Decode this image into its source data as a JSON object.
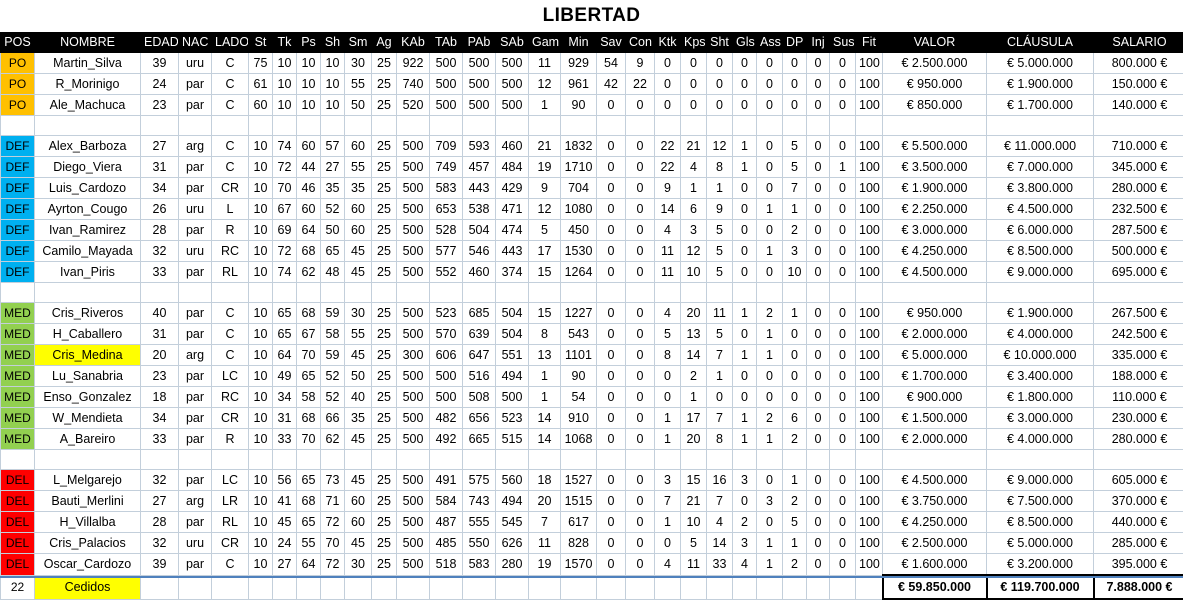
{
  "title": "LIBERTAD",
  "columns": [
    "POS",
    "NOMBRE",
    "EDAD",
    "NAC",
    "LADO",
    "St",
    "Tk",
    "Ps",
    "Sh",
    "Sm",
    "Ag",
    "KAb",
    "TAb",
    "PAb",
    "SAb",
    "Gam",
    "Min",
    "Sav",
    "Con",
    "Ktk",
    "Kps",
    "Sht",
    "Gls",
    "Ass",
    "DP",
    "Inj",
    "Sus",
    "Fit",
    "VALOR",
    "CLÁUSULA",
    "SALARIO"
  ],
  "colors": {
    "pos_po": "#FFC000",
    "pos_def": "#00B0F0",
    "pos_med": "#92D050",
    "pos_del": "#FF0000",
    "highlight": "#FFFF00",
    "header_bg": "#000000",
    "header_fg": "#FFFFFF",
    "gridline": "#C3CFDB"
  },
  "rows": [
    {
      "type": "data",
      "pos": "PO",
      "group": "po",
      "bold_col": "St",
      "name": "Martin_Silva",
      "edad": "39",
      "nac": "uru",
      "lado": "C",
      "st": "75",
      "tk": "10",
      "ps": "10",
      "sh": "10",
      "sm": "30",
      "ag": "25",
      "kab": "922",
      "tab": "500",
      "pab": "500",
      "sab": "500",
      "gam": "11",
      "min": "929",
      "sav": "54",
      "con": "9",
      "ktk": "0",
      "kps": "0",
      "sht": "0",
      "gls": "0",
      "ass": "0",
      "dp": "0",
      "inj": "0",
      "sus": "0",
      "fit": "100",
      "valor": "€ 2.500.000",
      "clausula": "€ 5.000.000",
      "salario": "800.000 €"
    },
    {
      "type": "data",
      "pos": "PO",
      "group": "po",
      "bold_col": "St",
      "name": "R_Morinigo",
      "edad": "24",
      "nac": "par",
      "lado": "C",
      "st": "61",
      "tk": "10",
      "ps": "10",
      "sh": "10",
      "sm": "55",
      "ag": "25",
      "kab": "740",
      "tab": "500",
      "pab": "500",
      "sab": "500",
      "gam": "12",
      "min": "961",
      "sav": "42",
      "con": "22",
      "ktk": "0",
      "kps": "0",
      "sht": "0",
      "gls": "0",
      "ass": "0",
      "dp": "0",
      "inj": "0",
      "sus": "0",
      "fit": "100",
      "valor": "€ 950.000",
      "clausula": "€ 1.900.000",
      "salario": "150.000 €"
    },
    {
      "type": "data",
      "pos": "PO",
      "group": "po",
      "bold_col": "St",
      "name": "Ale_Machuca",
      "edad": "23",
      "nac": "par",
      "lado": "C",
      "st": "60",
      "tk": "10",
      "ps": "10",
      "sh": "10",
      "sm": "50",
      "ag": "25",
      "kab": "520",
      "tab": "500",
      "pab": "500",
      "sab": "500",
      "gam": "1",
      "min": "90",
      "sav": "0",
      "con": "0",
      "ktk": "0",
      "kps": "0",
      "sht": "0",
      "gls": "0",
      "ass": "0",
      "dp": "0",
      "inj": "0",
      "sus": "0",
      "fit": "100",
      "valor": "€ 850.000",
      "clausula": "€ 1.700.000",
      "salario": "140.000 €"
    },
    {
      "type": "spacer"
    },
    {
      "type": "data",
      "pos": "DEF",
      "group": "def",
      "bold_col": "Tk",
      "name": "Alex_Barboza",
      "edad": "27",
      "nac": "arg",
      "lado": "C",
      "st": "10",
      "tk": "74",
      "ps": "60",
      "sh": "57",
      "sm": "60",
      "ag": "25",
      "kab": "500",
      "tab": "709",
      "pab": "593",
      "sab": "460",
      "gam": "21",
      "min": "1832",
      "sav": "0",
      "con": "0",
      "ktk": "22",
      "kps": "21",
      "sht": "12",
      "gls": "1",
      "ass": "0",
      "dp": "5",
      "inj": "0",
      "sus": "0",
      "fit": "100",
      "valor": "€ 5.500.000",
      "clausula": "€ 11.000.000",
      "salario": "710.000 €"
    },
    {
      "type": "data",
      "pos": "DEF",
      "group": "def",
      "bold_col": "Tk",
      "name": "Diego_Viera",
      "edad": "31",
      "nac": "par",
      "lado": "C",
      "st": "10",
      "tk": "72",
      "ps": "44",
      "sh": "27",
      "sm": "55",
      "ag": "25",
      "kab": "500",
      "tab": "749",
      "pab": "457",
      "sab": "484",
      "gam": "19",
      "min": "1710",
      "sav": "0",
      "con": "0",
      "ktk": "22",
      "kps": "4",
      "sht": "8",
      "gls": "1",
      "ass": "0",
      "dp": "5",
      "inj": "0",
      "sus": "1",
      "fit": "100",
      "valor": "€ 3.500.000",
      "clausula": "€ 7.000.000",
      "salario": "345.000 €"
    },
    {
      "type": "data",
      "pos": "DEF",
      "group": "def",
      "bold_col": "Tk",
      "name": "Luis_Cardozo",
      "edad": "34",
      "nac": "par",
      "lado": "CR",
      "st": "10",
      "tk": "70",
      "ps": "46",
      "sh": "35",
      "sm": "35",
      "ag": "25",
      "kab": "500",
      "tab": "583",
      "pab": "443",
      "sab": "429",
      "gam": "9",
      "min": "704",
      "sav": "0",
      "con": "0",
      "ktk": "9",
      "kps": "1",
      "sht": "1",
      "gls": "0",
      "ass": "0",
      "dp": "7",
      "inj": "0",
      "sus": "0",
      "fit": "100",
      "valor": "€ 1.900.000",
      "clausula": "€ 3.800.000",
      "salario": "280.000 €"
    },
    {
      "type": "data",
      "pos": "DEF",
      "group": "def",
      "bold_col": "Tk",
      "name": "Ayrton_Cougo",
      "edad": "26",
      "nac": "uru",
      "lado": "L",
      "st": "10",
      "tk": "67",
      "ps": "60",
      "sh": "52",
      "sm": "60",
      "ag": "25",
      "kab": "500",
      "tab": "653",
      "pab": "538",
      "sab": "471",
      "gam": "12",
      "min": "1080",
      "sav": "0",
      "con": "0",
      "ktk": "14",
      "kps": "6",
      "sht": "9",
      "gls": "0",
      "ass": "1",
      "dp": "1",
      "inj": "0",
      "sus": "0",
      "fit": "100",
      "valor": "€ 2.250.000",
      "clausula": "€ 4.500.000",
      "salario": "232.500 €"
    },
    {
      "type": "data",
      "pos": "DEF",
      "group": "def",
      "bold_col": "Tk",
      "name": "Ivan_Ramirez",
      "edad": "28",
      "nac": "par",
      "lado": "R",
      "st": "10",
      "tk": "69",
      "ps": "64",
      "sh": "50",
      "sm": "60",
      "ag": "25",
      "kab": "500",
      "tab": "528",
      "pab": "504",
      "sab": "474",
      "gam": "5",
      "min": "450",
      "sav": "0",
      "con": "0",
      "ktk": "4",
      "kps": "3",
      "sht": "5",
      "gls": "0",
      "ass": "0",
      "dp": "2",
      "inj": "0",
      "sus": "0",
      "fit": "100",
      "valor": "€ 3.000.000",
      "clausula": "€ 6.000.000",
      "salario": "287.500 €"
    },
    {
      "type": "data",
      "pos": "DEF",
      "group": "def",
      "bold_col": "Tk",
      "name": "Camilo_Mayada",
      "edad": "32",
      "nac": "uru",
      "lado": "RC",
      "st": "10",
      "tk": "72",
      "ps": "68",
      "sh": "65",
      "sm": "45",
      "ag": "25",
      "kab": "500",
      "tab": "577",
      "pab": "546",
      "sab": "443",
      "gam": "17",
      "min": "1530",
      "sav": "0",
      "con": "0",
      "ktk": "11",
      "kps": "12",
      "sht": "5",
      "gls": "0",
      "ass": "1",
      "dp": "3",
      "inj": "0",
      "sus": "0",
      "fit": "100",
      "valor": "€ 4.250.000",
      "clausula": "€ 8.500.000",
      "salario": "500.000 €"
    },
    {
      "type": "data",
      "pos": "DEF",
      "group": "def",
      "bold_col": "Tk",
      "name": "Ivan_Piris",
      "edad": "33",
      "nac": "par",
      "lado": "RL",
      "st": "10",
      "tk": "74",
      "ps": "62",
      "sh": "48",
      "sm": "45",
      "ag": "25",
      "kab": "500",
      "tab": "552",
      "pab": "460",
      "sab": "374",
      "gam": "15",
      "min": "1264",
      "sav": "0",
      "con": "0",
      "ktk": "11",
      "kps": "10",
      "sht": "5",
      "gls": "0",
      "ass": "0",
      "dp": "10",
      "inj": "0",
      "sus": "0",
      "fit": "100",
      "valor": "€ 4.500.000",
      "clausula": "€ 9.000.000",
      "salario": "695.000 €"
    },
    {
      "type": "spacer"
    },
    {
      "type": "data",
      "pos": "MED",
      "group": "med",
      "bold_col": "Ps",
      "name": "Cris_Riveros",
      "edad": "40",
      "nac": "par",
      "lado": "C",
      "st": "10",
      "tk": "65",
      "ps": "68",
      "sh": "59",
      "sm": "30",
      "ag": "25",
      "kab": "500",
      "tab": "523",
      "pab": "685",
      "sab": "504",
      "gam": "15",
      "min": "1227",
      "sav": "0",
      "con": "0",
      "ktk": "4",
      "kps": "20",
      "sht": "11",
      "gls": "1",
      "ass": "2",
      "dp": "1",
      "inj": "0",
      "sus": "0",
      "fit": "100",
      "valor": "€ 950.000",
      "clausula": "€ 1.900.000",
      "salario": "267.500 €"
    },
    {
      "type": "data",
      "pos": "MED",
      "group": "med",
      "bold_col": "Ps",
      "name": "H_Caballero",
      "edad": "31",
      "nac": "par",
      "lado": "C",
      "st": "10",
      "tk": "65",
      "ps": "67",
      "sh": "58",
      "sm": "55",
      "ag": "25",
      "kab": "500",
      "tab": "570",
      "pab": "639",
      "sab": "504",
      "gam": "8",
      "min": "543",
      "sav": "0",
      "con": "0",
      "ktk": "5",
      "kps": "13",
      "sht": "5",
      "gls": "0",
      "ass": "1",
      "dp": "0",
      "inj": "0",
      "sus": "0",
      "fit": "100",
      "valor": "€ 2.000.000",
      "clausula": "€ 4.000.000",
      "salario": "242.500 €"
    },
    {
      "type": "data",
      "pos": "MED",
      "group": "med",
      "bold_col": "Ps",
      "highlight": true,
      "name": "Cris_Medina",
      "edad": "20",
      "nac": "arg",
      "lado": "C",
      "st": "10",
      "tk": "64",
      "ps": "70",
      "sh": "59",
      "sm": "45",
      "ag": "25",
      "kab": "300",
      "tab": "606",
      "pab": "647",
      "sab": "551",
      "gam": "13",
      "min": "1101",
      "sav": "0",
      "con": "0",
      "ktk": "8",
      "kps": "14",
      "sht": "7",
      "gls": "1",
      "ass": "1",
      "dp": "0",
      "inj": "0",
      "sus": "0",
      "fit": "100",
      "valor": "€ 5.000.000",
      "clausula": "€ 10.000.000",
      "salario": "335.000 €"
    },
    {
      "type": "data",
      "pos": "MED",
      "group": "med",
      "bold_col": "Ps",
      "name": "Lu_Sanabria",
      "edad": "23",
      "nac": "par",
      "lado": "LC",
      "st": "10",
      "tk": "49",
      "ps": "65",
      "sh": "52",
      "sm": "50",
      "ag": "25",
      "kab": "500",
      "tab": "500",
      "pab": "516",
      "sab": "494",
      "gam": "1",
      "min": "90",
      "sav": "0",
      "con": "0",
      "ktk": "0",
      "kps": "2",
      "sht": "1",
      "gls": "0",
      "ass": "0",
      "dp": "0",
      "inj": "0",
      "sus": "0",
      "fit": "100",
      "valor": "€ 1.700.000",
      "clausula": "€ 3.400.000",
      "salario": "188.000 €"
    },
    {
      "type": "data",
      "pos": "MED",
      "group": "med",
      "bold_col": "Ps",
      "name": "Enso_Gonzalez",
      "edad": "18",
      "nac": "par",
      "lado": "RC",
      "st": "10",
      "tk": "34",
      "ps": "58",
      "sh": "52",
      "sm": "40",
      "ag": "25",
      "kab": "500",
      "tab": "500",
      "pab": "508",
      "sab": "500",
      "gam": "1",
      "min": "54",
      "sav": "0",
      "con": "0",
      "ktk": "0",
      "kps": "1",
      "sht": "0",
      "gls": "0",
      "ass": "0",
      "dp": "0",
      "inj": "0",
      "sus": "0",
      "fit": "100",
      "valor": "€ 900.000",
      "clausula": "€ 1.800.000",
      "salario": "110.000 €"
    },
    {
      "type": "data",
      "pos": "MED",
      "group": "med",
      "bold_col": "Ps",
      "name": "W_Mendieta",
      "edad": "34",
      "nac": "par",
      "lado": "CR",
      "st": "10",
      "tk": "31",
      "ps": "68",
      "sh": "66",
      "sm": "35",
      "ag": "25",
      "kab": "500",
      "tab": "482",
      "pab": "656",
      "sab": "523",
      "gam": "14",
      "min": "910",
      "sav": "0",
      "con": "0",
      "ktk": "1",
      "kps": "17",
      "sht": "7",
      "gls": "1",
      "ass": "2",
      "dp": "6",
      "inj": "0",
      "sus": "0",
      "fit": "100",
      "valor": "€ 1.500.000",
      "clausula": "€ 3.000.000",
      "salario": "230.000 €"
    },
    {
      "type": "data",
      "pos": "MED",
      "group": "med",
      "bold_col": "Ps",
      "name": "A_Bareiro",
      "edad": "33",
      "nac": "par",
      "lado": "R",
      "st": "10",
      "tk": "33",
      "ps": "70",
      "sh": "62",
      "sm": "45",
      "ag": "25",
      "kab": "500",
      "tab": "492",
      "pab": "665",
      "sab": "515",
      "gam": "14",
      "min": "1068",
      "sav": "0",
      "con": "0",
      "ktk": "1",
      "kps": "20",
      "sht": "8",
      "gls": "1",
      "ass": "1",
      "dp": "2",
      "inj": "0",
      "sus": "0",
      "fit": "100",
      "valor": "€ 2.000.000",
      "clausula": "€ 4.000.000",
      "salario": "280.000 €"
    },
    {
      "type": "spacer"
    },
    {
      "type": "data",
      "pos": "DEL",
      "group": "del",
      "bold_col": "Sh",
      "name": "L_Melgarejo",
      "edad": "32",
      "nac": "par",
      "lado": "LC",
      "st": "10",
      "tk": "56",
      "ps": "65",
      "sh": "73",
      "sm": "45",
      "ag": "25",
      "kab": "500",
      "tab": "491",
      "pab": "575",
      "sab": "560",
      "gam": "18",
      "min": "1527",
      "sav": "0",
      "con": "0",
      "ktk": "3",
      "kps": "15",
      "sht": "16",
      "gls": "3",
      "ass": "0",
      "dp": "1",
      "inj": "0",
      "sus": "0",
      "fit": "100",
      "valor": "€ 4.500.000",
      "clausula": "€ 9.000.000",
      "salario": "605.000 €"
    },
    {
      "type": "data",
      "pos": "DEL",
      "group": "del",
      "bold_col": "Sh",
      "name": "Bauti_Merlini",
      "edad": "27",
      "nac": "arg",
      "lado": "LR",
      "st": "10",
      "tk": "41",
      "ps": "68",
      "sh": "71",
      "sm": "60",
      "ag": "25",
      "kab": "500",
      "tab": "584",
      "pab": "743",
      "sab": "494",
      "gam": "20",
      "min": "1515",
      "sav": "0",
      "con": "0",
      "ktk": "7",
      "kps": "21",
      "sht": "7",
      "gls": "0",
      "ass": "3",
      "dp": "2",
      "inj": "0",
      "sus": "0",
      "fit": "100",
      "valor": "€ 3.750.000",
      "clausula": "€ 7.500.000",
      "salario": "370.000 €"
    },
    {
      "type": "data",
      "pos": "DEL",
      "group": "del",
      "bold_col": "Sh",
      "name": "H_Villalba",
      "edad": "28",
      "nac": "par",
      "lado": "RL",
      "st": "10",
      "tk": "45",
      "ps": "65",
      "sh": "72",
      "sm": "60",
      "ag": "25",
      "kab": "500",
      "tab": "487",
      "pab": "555",
      "sab": "545",
      "gam": "7",
      "min": "617",
      "sav": "0",
      "con": "0",
      "ktk": "1",
      "kps": "10",
      "sht": "4",
      "gls": "2",
      "ass": "0",
      "dp": "5",
      "inj": "0",
      "sus": "0",
      "fit": "100",
      "valor": "€ 4.250.000",
      "clausula": "€ 8.500.000",
      "salario": "440.000 €"
    },
    {
      "type": "data",
      "pos": "DEL",
      "group": "del",
      "bold_col": "Sh",
      "name": "Cris_Palacios",
      "edad": "32",
      "nac": "uru",
      "lado": "CR",
      "st": "10",
      "tk": "24",
      "ps": "55",
      "sh": "70",
      "sm": "45",
      "ag": "25",
      "kab": "500",
      "tab": "485",
      "pab": "550",
      "sab": "626",
      "gam": "11",
      "min": "828",
      "sav": "0",
      "con": "0",
      "ktk": "0",
      "kps": "5",
      "sht": "14",
      "gls": "3",
      "ass": "1",
      "dp": "1",
      "inj": "0",
      "sus": "0",
      "fit": "100",
      "valor": "€ 2.500.000",
      "clausula": "€ 5.000.000",
      "salario": "285.000 €"
    },
    {
      "type": "data",
      "pos": "DEL",
      "group": "del",
      "bold_col": "Sh",
      "name": "Oscar_Cardozo",
      "edad": "39",
      "nac": "par",
      "lado": "C",
      "st": "10",
      "tk": "27",
      "ps": "64",
      "sh": "72",
      "sm": "30",
      "ag": "25",
      "kab": "500",
      "tab": "518",
      "pab": "583",
      "sab": "280",
      "gam": "19",
      "min": "1570",
      "sav": "0",
      "con": "0",
      "ktk": "4",
      "kps": "11",
      "sht": "33",
      "gls": "4",
      "ass": "1",
      "dp": "2",
      "inj": "0",
      "sus": "0",
      "fit": "100",
      "valor": "€ 1.600.000",
      "clausula": "€ 3.200.000",
      "salario": "395.000 €"
    }
  ],
  "totals": {
    "count": "22",
    "label": "Cedidos",
    "valor": "€ 59.850.000",
    "clausula": "€ 119.700.000",
    "salario": "7.888.000 €"
  }
}
